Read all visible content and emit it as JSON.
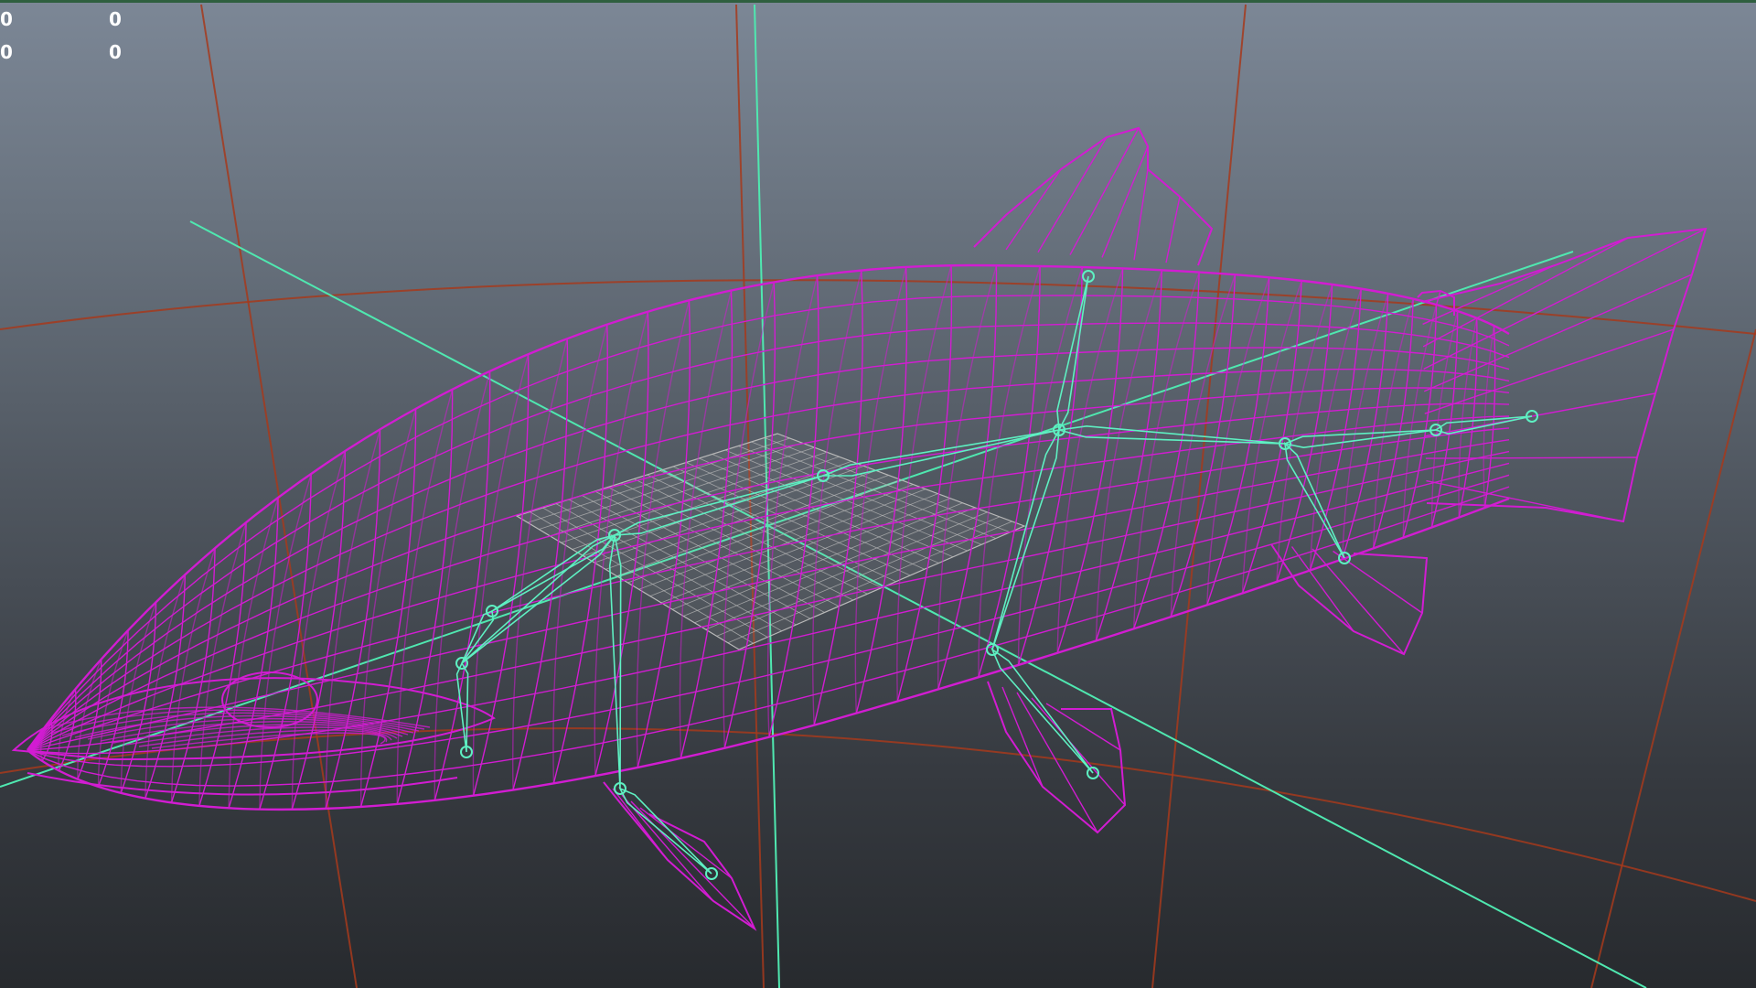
{
  "viewport": {
    "background_top": "#7c8796",
    "background_bottom": "#272a2e"
  },
  "hud": {
    "row1": {
      "a": "0",
      "b": "0"
    },
    "row2": {
      "a": "0",
      "b": "0"
    }
  },
  "colors": {
    "mesh_wireframe": "#d21cd2",
    "skeleton": "#5ef0c2",
    "world_grid": "#a63a1c",
    "axis_lines": "#4fe8b0",
    "ground_plane": "#b9b9b9"
  },
  "objects": {
    "mesh": "fish-wireframe-mesh",
    "rig": "fish-skeleton-joints",
    "plane": "grid-plane"
  }
}
